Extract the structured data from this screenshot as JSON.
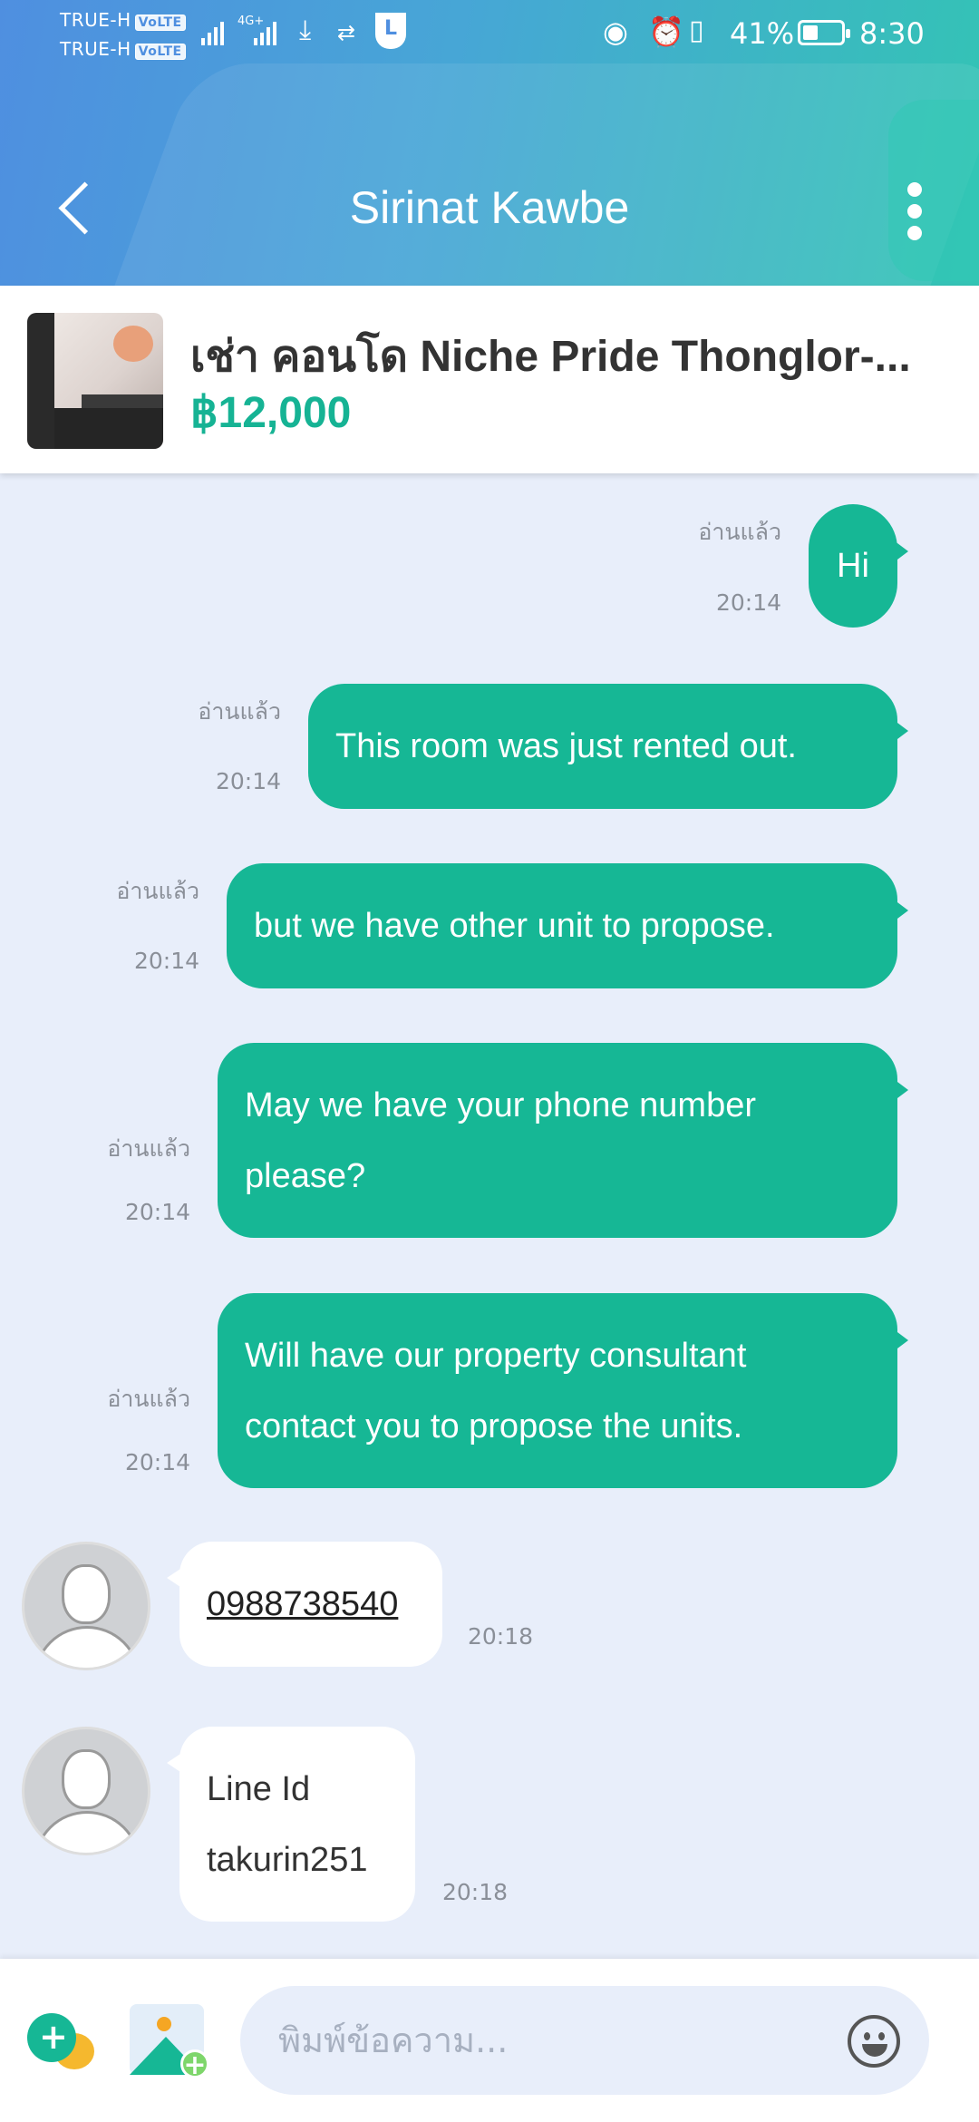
{
  "status_bar": {
    "carrier_1": "TRUE-H",
    "carrier_2": "TRUE-H",
    "volte": "VoLTE",
    "network": "4G+",
    "battery": "41%",
    "battery_level": 0.41,
    "time": "8:30"
  },
  "header": {
    "title": "Sirinat Kawbe"
  },
  "listing": {
    "title": "เช่า คอนโด  Niche Pride Thonglor-...",
    "price": "฿12,000"
  },
  "messages": [
    {
      "direction": "out",
      "text": "Hi",
      "read": "อ่านแล้ว",
      "time": "20:14"
    },
    {
      "direction": "out",
      "text": "This room was just rented out.",
      "read": "อ่านแล้ว",
      "time": "20:14"
    },
    {
      "direction": "out",
      "text": "but we have other unit to propose.",
      "read": "อ่านแล้ว",
      "time": "20:14"
    },
    {
      "direction": "out",
      "text_line1": "May we have your phone number",
      "text_line2": "please?",
      "read": "อ่านแล้ว",
      "time": "20:14"
    },
    {
      "direction": "out",
      "text_line1": "Will have our property consultant",
      "text_line2": "contact you to propose the units.",
      "read": "อ่านแล้ว",
      "time": "20:14"
    },
    {
      "direction": "in",
      "text": "0988738540",
      "time": "20:18"
    },
    {
      "direction": "in",
      "text_line1": "Line Id",
      "text_line2": "takurin251",
      "time": "20:18"
    }
  ],
  "input": {
    "placeholder": "พิมพ์ข้อความ..."
  },
  "colors": {
    "accent": "#16b795",
    "header_start": "#4f8fe0",
    "header_end": "#33c4b4",
    "background": "#e8eefa"
  }
}
